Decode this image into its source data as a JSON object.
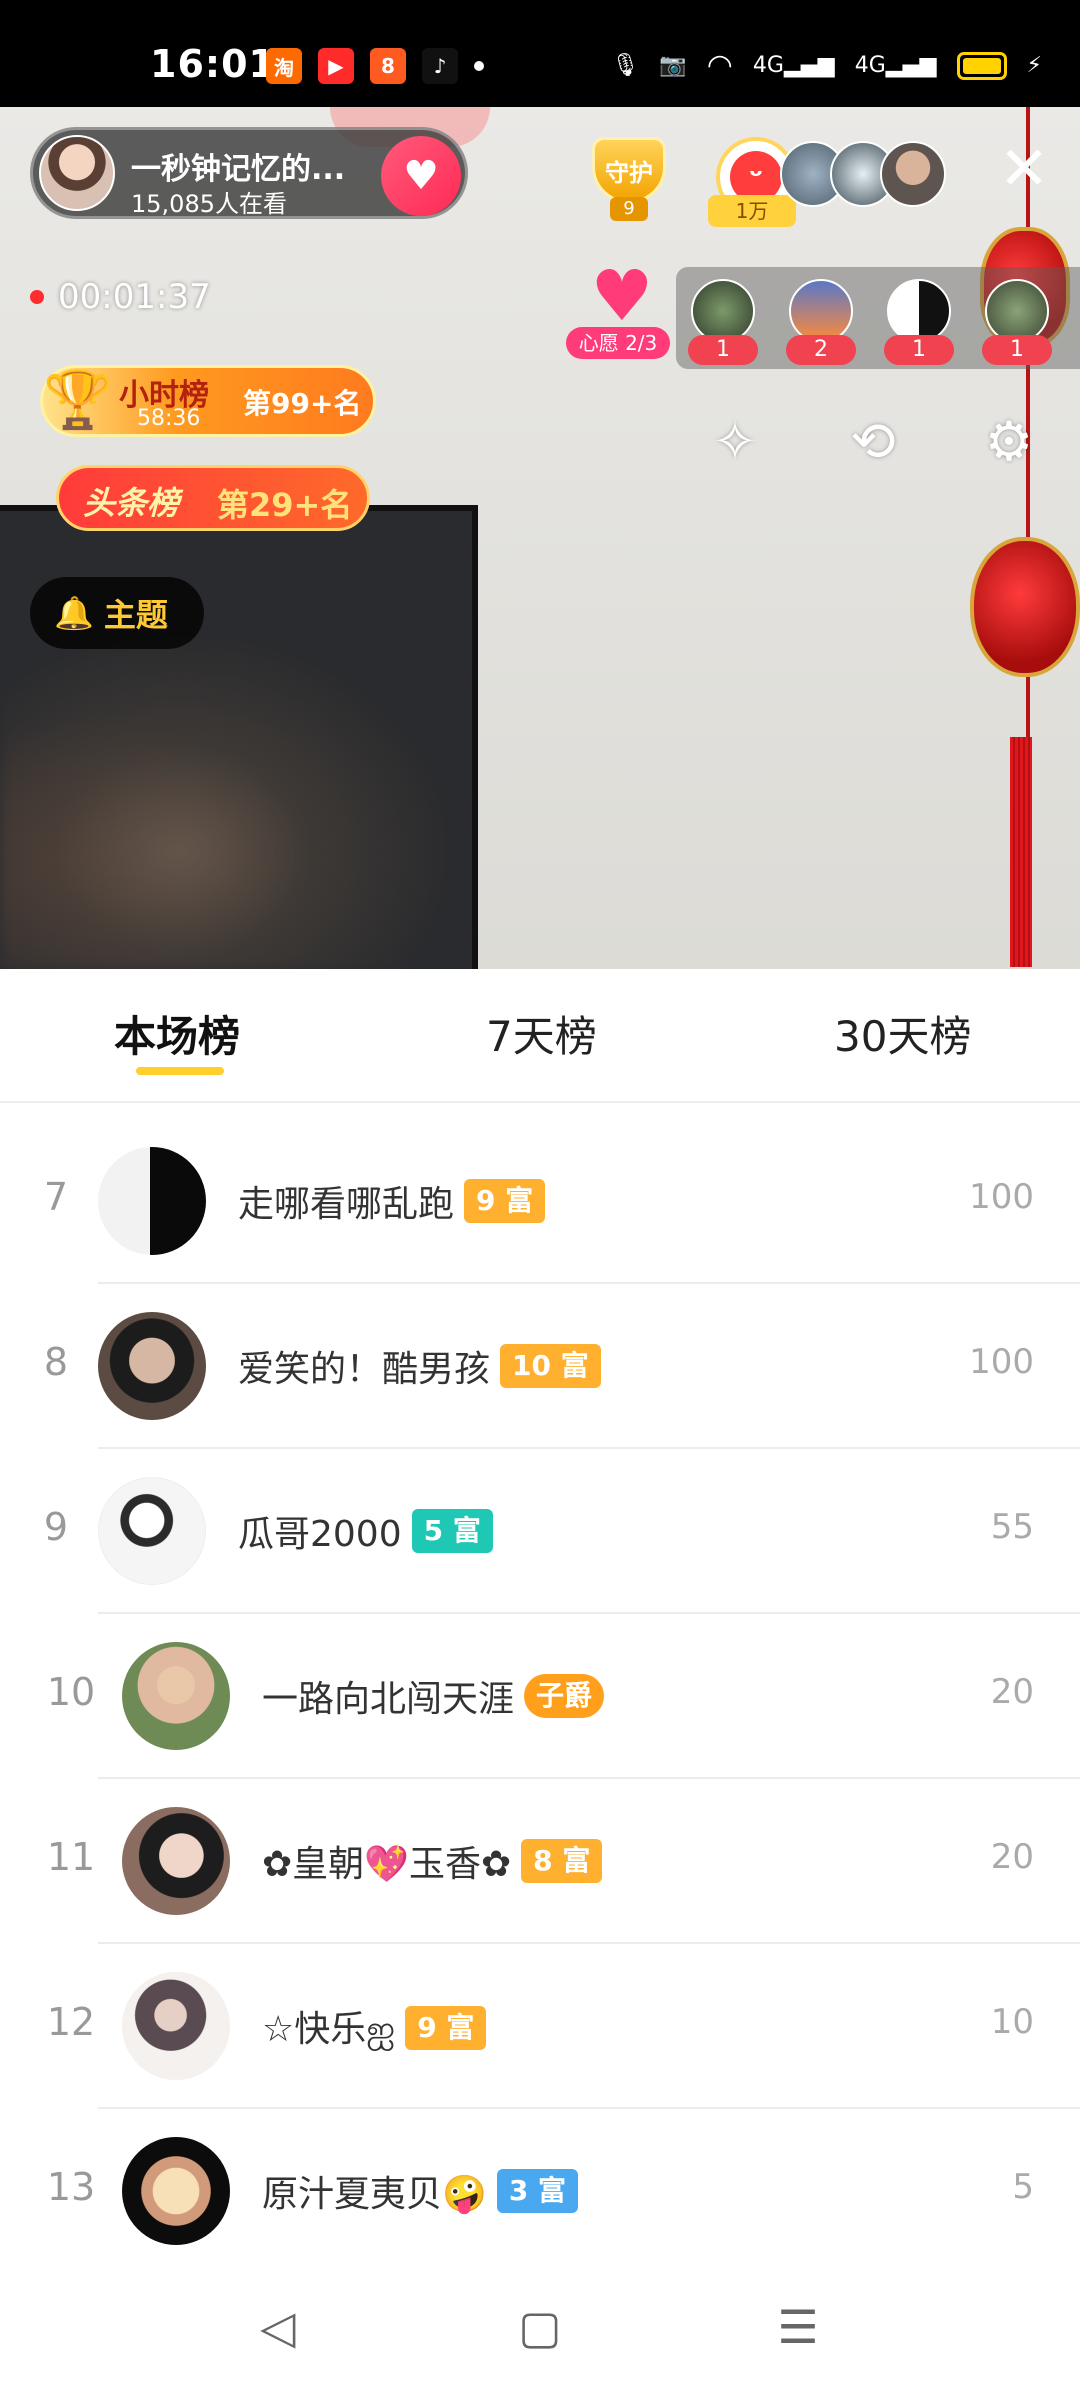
{
  "status_bar": {
    "time": "16:01",
    "apps": [
      {
        "icon": "taobao-icon",
        "glyph": "淘",
        "color": "#ff6a00"
      },
      {
        "icon": "video-app-icon",
        "glyph": "▶",
        "color": "#ff2b2b"
      },
      {
        "icon": "kuaishou-icon",
        "glyph": "8",
        "color": "#ff5a1f"
      },
      {
        "icon": "douyin-icon",
        "glyph": "♪",
        "color": "#111111"
      }
    ],
    "network_label": "4G",
    "network_label_2": "4G"
  },
  "live": {
    "host_name": "一秒钟记忆的...",
    "viewers": "15,085人在看",
    "guard_label": "守护",
    "guard_count": "9",
    "fan_count": "1万",
    "rec_time": "00:01:37",
    "wish_label": "心愿 2/3",
    "gifts": [
      "1",
      "2",
      "1",
      "1"
    ],
    "rank_hour": {
      "title": "小时榜",
      "time": "58:36",
      "position": "第99+名"
    },
    "rank_head": {
      "title": "头条榜",
      "position": "第29+名"
    },
    "topic": "主题"
  },
  "tabs": [
    {
      "label": "本场榜"
    },
    {
      "label": "7天榜"
    },
    {
      "label": "30天榜"
    }
  ],
  "rows": [
    {
      "rank": "7",
      "name": "走哪看哪乱跑",
      "badge": "9 富",
      "badge_color": "#ffb02e",
      "score": "100"
    },
    {
      "rank": "8",
      "name": "爱笑的！酷男孩",
      "badge": "10 富",
      "badge_color": "#ffb02e",
      "score": "100"
    },
    {
      "rank": "9",
      "name": "瓜哥2000",
      "badge": "5 富",
      "badge_color": "#1ec8b4",
      "score": "55"
    },
    {
      "rank": "10",
      "name": "一路向北闯天涯",
      "badge": "子爵",
      "badge_color": "#ff9f1c",
      "score": "20"
    },
    {
      "rank": "11",
      "name": "✿皇朝💖玉香✿",
      "badge": "8 富",
      "badge_color": "#ffb02e",
      "score": "20"
    },
    {
      "rank": "12",
      "name": "☆快乐ஐ",
      "badge": "9 富",
      "badge_color": "#ffb02e",
      "score": "10"
    },
    {
      "rank": "13",
      "name": "原汁夏夷贝🤪",
      "badge": "3 富",
      "badge_color": "#4aa8f0",
      "score": "5"
    }
  ],
  "nav": {
    "back": "◁",
    "home": "▢",
    "menu": "☰"
  }
}
